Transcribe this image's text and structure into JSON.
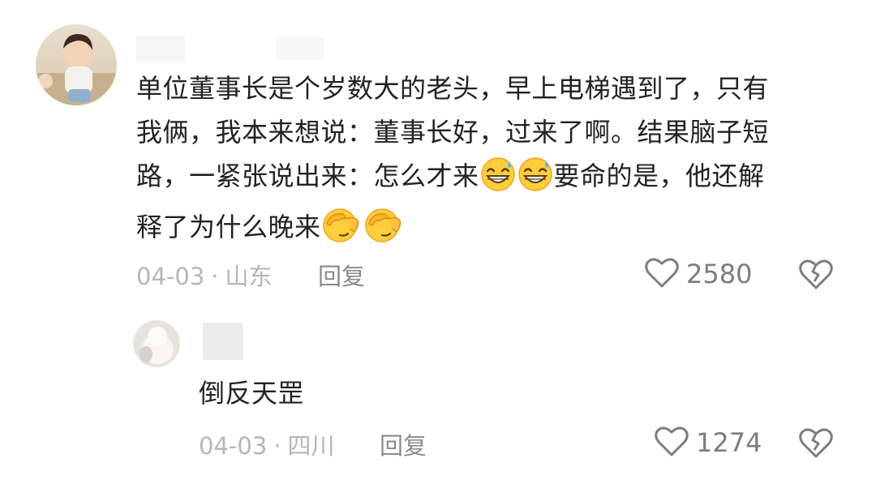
{
  "comments": [
    {
      "lines": [
        "单位董事长是个岁数大的老头，早上电梯遇到了，只有",
        "我俩，我本来想说：董事长好，过来了啊。结果脑子短",
        "路，一紧张说出来：怎么才来",
        "要命的是，他还解",
        "释了为什么晚来"
      ],
      "emoji_after_line3": "grinning-sweat-emoji",
      "emoji_after_line4": "facepalm-emoji",
      "date": "04-03",
      "separator": "·",
      "location": "山东",
      "reply_label": "回复",
      "like_count": "2580"
    }
  ],
  "replies": [
    {
      "text": "倒反天罡",
      "date": "04-03",
      "separator": "·",
      "location": "四川",
      "reply_label": "回复",
      "like_count": "1274"
    }
  ],
  "icons": {
    "like": "heart-outline-icon",
    "dislike": "broken-heart-icon"
  },
  "colors": {
    "text": "#222222",
    "meta": "#b6b6b6",
    "reply": "#8a8a8a",
    "icon": "#7d7d7d"
  }
}
